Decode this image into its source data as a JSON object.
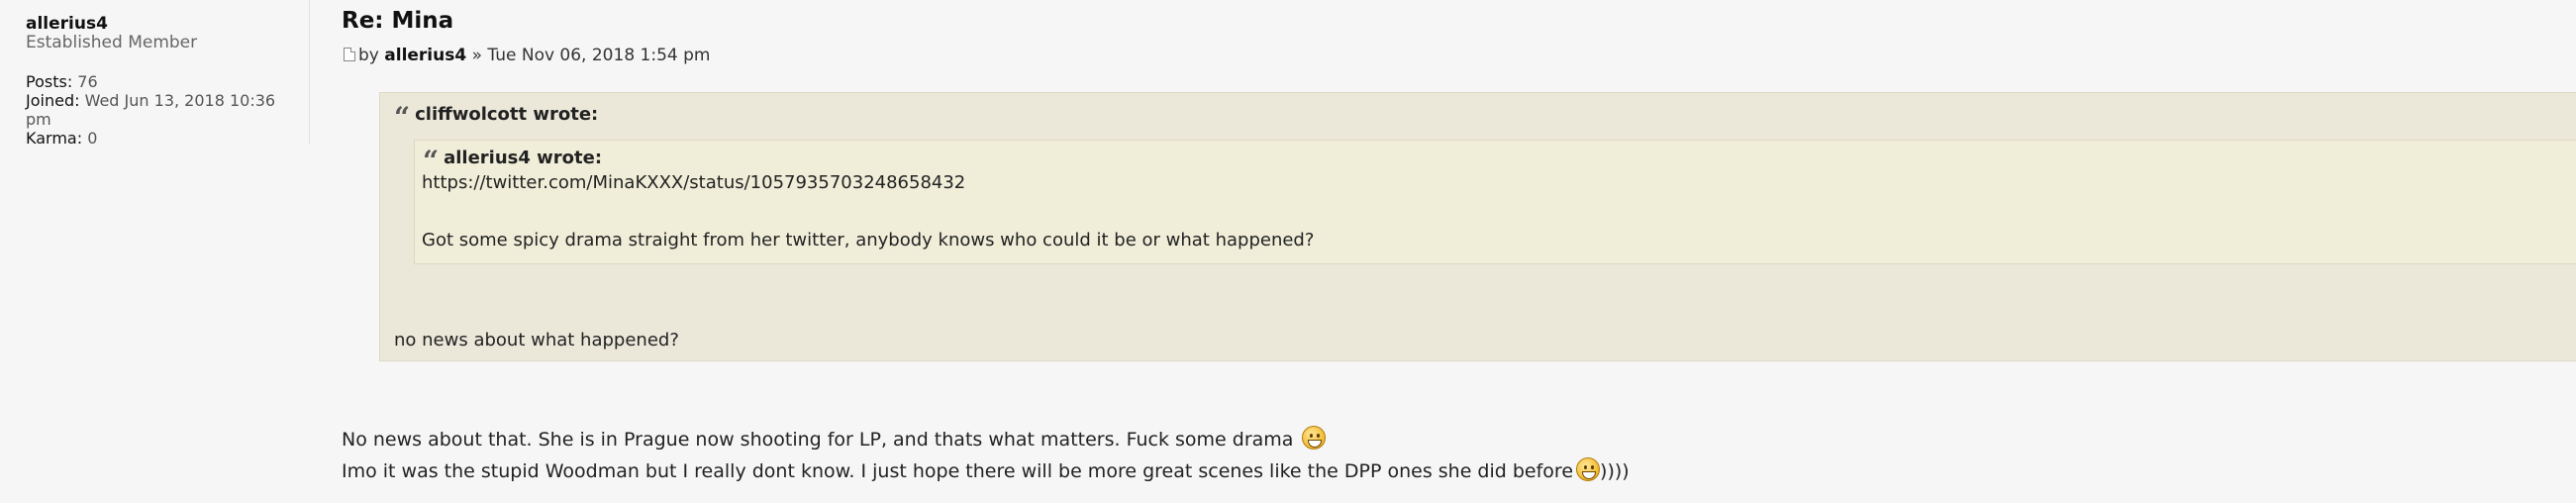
{
  "profile": {
    "username": "allerius4",
    "rank": "Established Member",
    "posts_label": "Posts:",
    "posts_value": "76",
    "joined_label": "Joined:",
    "joined_value_line1": "Wed Jun 13, 2018 10:36",
    "joined_value_line2": "pm",
    "karma_label": "Karma:",
    "karma_value": "0"
  },
  "post": {
    "title": "Re: Mina",
    "by_label": "by",
    "author": "allerius4",
    "separator": "»",
    "timestamp": "Tue Nov 06, 2018 1:54 pm",
    "outer_quote": {
      "author_wrote": "cliffwolcott wrote:",
      "reply": "no news about what happened?"
    },
    "inner_quote": {
      "author_wrote": "allerius4 wrote:",
      "link": "https://twitter.com/MinaKXXX/status/1057935703248658432",
      "text": "Got some spicy drama straight from her twitter, anybody knows who could it be or what happened?"
    },
    "line1": "No news about that. She is in Prague now shooting for LP, and thats what matters. Fuck some drama",
    "line2": "Imo it was the stupid Woodman but I really dont know. I just hope there will be more great scenes like the DPP ones she did before",
    "line2_suffix": "))))",
    "quote_glyph": "“"
  },
  "icons": [
    "post-icon",
    "quote-icon",
    "smiley-icon"
  ]
}
